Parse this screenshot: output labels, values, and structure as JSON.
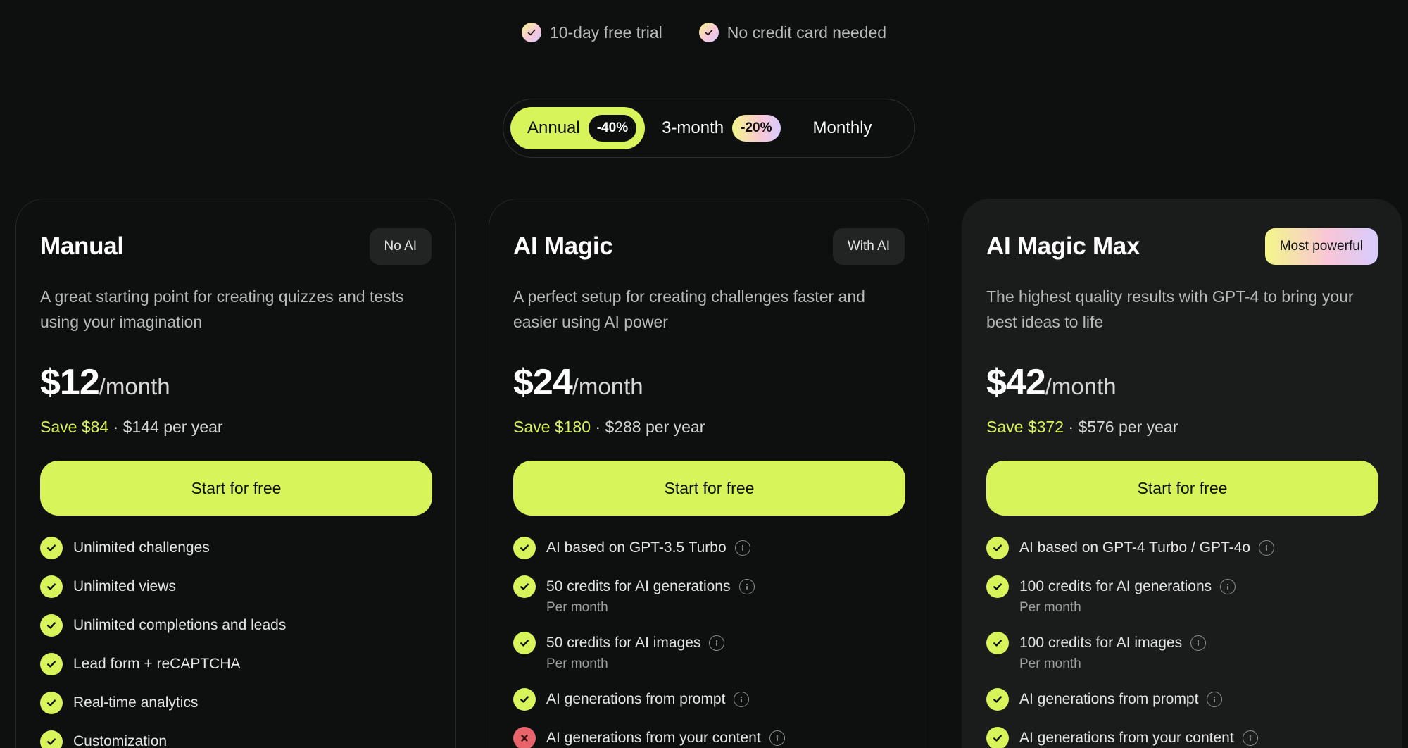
{
  "perks": [
    "10-day free trial",
    "No credit card needed"
  ],
  "billing": {
    "annual": {
      "label": "Annual",
      "badge": "-40%"
    },
    "quarterly": {
      "label": "3-month",
      "badge": "-20%"
    },
    "monthly": {
      "label": "Monthly"
    },
    "selected": "Annual"
  },
  "plans": [
    {
      "name": "Manual",
      "tag": "No AI",
      "description": "A great starting point for creating quizzes and tests using your imagination",
      "price": "$12",
      "period": "/month",
      "save": "Save $84",
      "separator": "·",
      "yearly": "$144 per year",
      "cta": "Start for free",
      "features": [
        {
          "text": "Unlimited challenges",
          "ok": true
        },
        {
          "text": "Unlimited views",
          "ok": true
        },
        {
          "text": "Unlimited completions and leads",
          "ok": true
        },
        {
          "text": "Lead form + reCAPTCHA",
          "ok": true
        },
        {
          "text": "Real-time analytics",
          "ok": true
        },
        {
          "text": "Customization",
          "ok": true
        }
      ]
    },
    {
      "name": "AI Magic",
      "tag": "With AI",
      "description": "A perfect setup for creating challenges faster and easier using AI power",
      "price": "$24",
      "period": "/month",
      "save": "Save $180",
      "separator": "·",
      "yearly": "$288 per year",
      "cta": "Start for free",
      "features": [
        {
          "text": "AI based on GPT-3.5 Turbo",
          "ok": true,
          "info": true
        },
        {
          "text": "50 credits for AI generations",
          "sub": "Per month",
          "ok": true,
          "info": true
        },
        {
          "text": "50 credits for AI images",
          "sub": "Per month",
          "ok": true,
          "info": true
        },
        {
          "text": "AI generations from prompt",
          "ok": true,
          "info": true
        },
        {
          "text": "AI generations from your content",
          "ok": false,
          "info": true
        }
      ]
    },
    {
      "name": "AI Magic Max",
      "tag": "Most powerful",
      "description": "The highest quality results with GPT-4 to bring your best ideas to life",
      "price": "$42",
      "period": "/month",
      "save": "Save $372",
      "separator": "·",
      "yearly": "$576 per year",
      "cta": "Start for free",
      "features": [
        {
          "text": "AI based on GPT-4 Turbo / GPT-4o",
          "ok": true,
          "info": true
        },
        {
          "text": "100 credits for AI generations",
          "sub": "Per month",
          "ok": true,
          "info": true
        },
        {
          "text": "100 credits for AI images",
          "sub": "Per month",
          "ok": true,
          "info": true
        },
        {
          "text": "AI generations from prompt",
          "ok": true,
          "info": true
        },
        {
          "text": "AI generations from your content",
          "ok": true,
          "info": true
        }
      ]
    }
  ],
  "colors": {
    "accent": "#d7f55a",
    "background": "#0e0f0f",
    "negative": "#e8666b"
  }
}
